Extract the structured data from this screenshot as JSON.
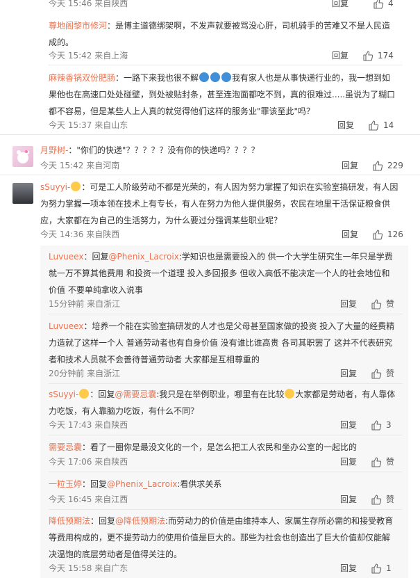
{
  "top": {
    "meta": "今天 15:46 来自陕西",
    "reply": "回复",
    "likes": "4"
  },
  "c1": {
    "user": "尊地阁黎市修河",
    "text": "：是博主道德绑架啊，不发声就要被骂没心肝，司机骑手的苦难又不是人民造成的。",
    "meta": "今天 15:42 来自上海",
    "reply": "回复",
    "likes": "174"
  },
  "c2": {
    "user": "麻辣香锅双份肥肠",
    "text_a": "：一路下来我也很不解",
    "text_b": "我有家人也是从事快递行业的，我一想到如果他也在高速口处处碰壁，到处被贴封条，甚至连泡面都吃不到，真的很难过.....虽说为了糊口都不容易，但是某些人上人真的就觉得他们这样的服务业\"罪该至此\"吗？",
    "meta": "今天 15:37 来自山东",
    "reply": "回复",
    "likes": "14"
  },
  "c3": {
    "user": "月野树-",
    "text": "：\"你们的快递\"？？？？？没有你的快递吗？？？？",
    "meta": "今天 15:42 来自河南",
    "reply": "回复",
    "likes": "229"
  },
  "c4": {
    "user": "sSuyyi-",
    "text": "：可是工人阶级劳动不都是光荣的，有人因为努力掌握了知识在实验室搞研发，有人因为努力掌握一项本领在技术上有专长，有人在努力为他人提供服务，农民在地里干活保证粮食供应，大家都在为自己的生活努力，为什么要过分强调某些职业呢？",
    "meta": "今天 14:36 来自陕西",
    "reply": "回复",
    "likes": "126"
  },
  "replies": [
    {
      "user": "Luvueex",
      "pre": "：回复",
      "at": "@Phenix_Lacroix",
      "text": ":学知识也是需要投入的 供一个大学生研究生一年只是学费就一万不算其他费用 和投资一个道理 投入多回报多 但收入高低不能决定一个人的社会地位和价值 不要单纯拿收入说事",
      "meta": "15分钟前 来自浙江",
      "reply": "回复",
      "likes": "赞"
    },
    {
      "user": "Luvueex",
      "pre": "",
      "at": "",
      "text": "：培养一个能在实验室搞研发的人才也是父母甚至国家做的投资 投入了大量的经费精力造就了这样一个人 普通劳动者也有自身价值 没有谁比谁高贵 各司其职罢了 这并不代表研究者和技术人员就不会善待普通劳动者 大家都是互相尊重的",
      "meta": "20分钟前 来自浙江",
      "reply": "回复",
      "likes": "赞"
    },
    {
      "user": "sSuyyi-",
      "pre": "：回复",
      "at": "@需要忌囊",
      "text_a": ":我只是在举例职业，哪里有在比较",
      "text_b": "大家都是劳动者，有人靠体力吃饭，有人靠脑力吃饭，有什么不同？",
      "meta": "今天 17:43 来自陕西",
      "reply": "回复",
      "likes": "3"
    },
    {
      "user": "需要忌囊",
      "pre": "",
      "at": "",
      "text": "：看了一圈你是最没文化的一个，是怎么把工人农民和坐办公室的一起比的",
      "meta": "今天 17:06 来自陕西",
      "reply": "回复",
      "likes": "赞"
    },
    {
      "user": "一粒玉婷",
      "pre": "：回复",
      "at": "@Phenix_Lacroix",
      "text": ":看供求关系",
      "meta": "今天 16:45 来自江西",
      "reply": "回复",
      "likes": "赞"
    },
    {
      "user": "降低预期法",
      "pre": "：回复",
      "at": "@降低预期法",
      "text": ":而劳动力的价值是由维持本人、家属生存所必需的和接受教育等费用构成的，更不提劳动力的使用价值是巨大的。那些为社会也创造出了巨大价值却仅能解决温饱的底层劳动者是值得关注的。",
      "meta": "今天 15:58 来自广东",
      "reply": "回复",
      "likes": "1"
    }
  ],
  "colors": {
    "username": "#eb7350",
    "meta": "#808080",
    "text": "#333333",
    "reply_bg": "#f7f7f7"
  }
}
